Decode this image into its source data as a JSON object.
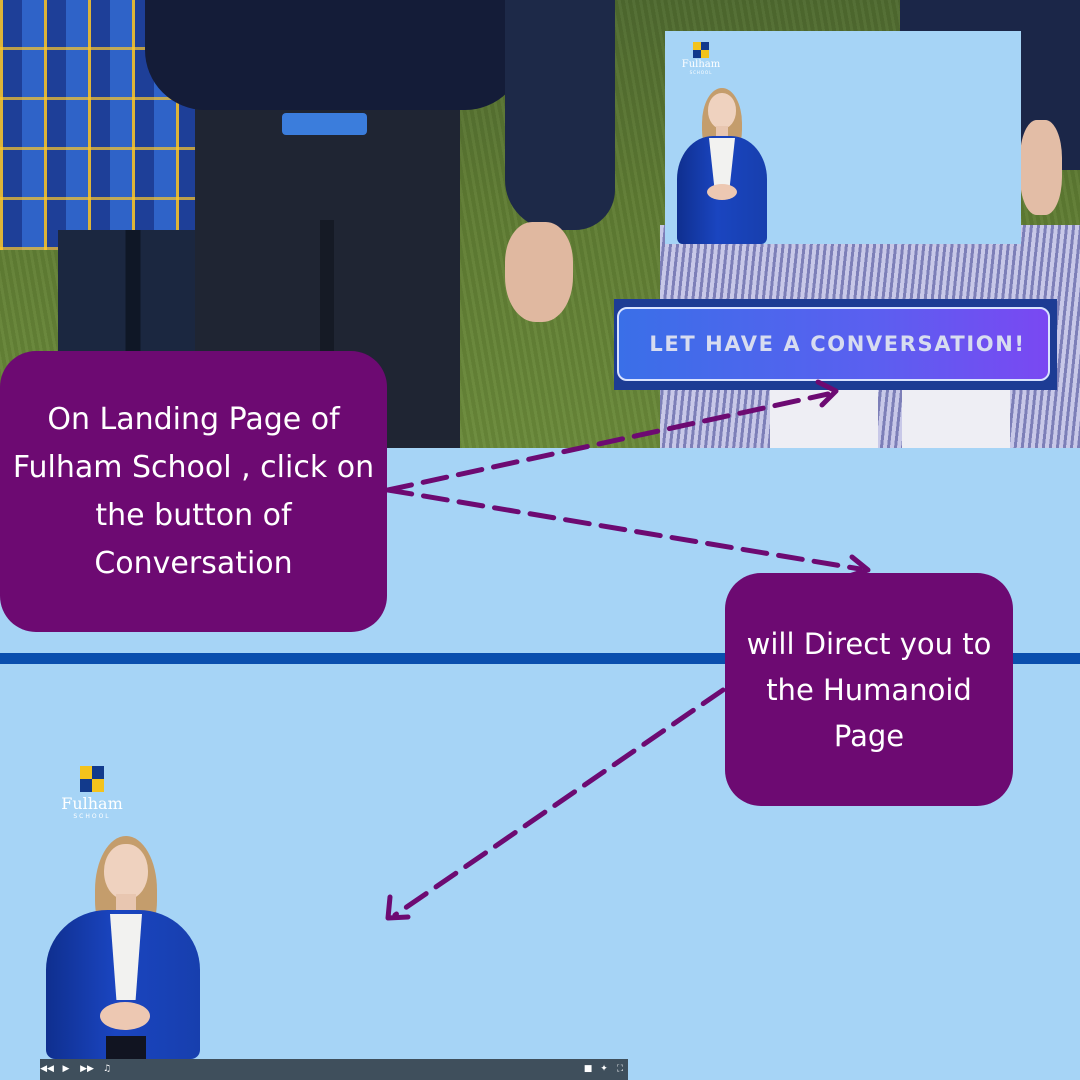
{
  "landing_screenshot": {
    "cta_button_label": "LET HAVE A CONVERSATION!",
    "thumbnail_logo": {
      "name": "Fulham",
      "sub": "SCHOOL"
    }
  },
  "callouts": {
    "step_one": "On Landing Page of Fulham School , click on the button of Conversation",
    "step_two": "will Direct you to the Humanoid Page"
  },
  "humanoid_page": {
    "logo": {
      "name": "Fulham",
      "sub": "SCHOOL"
    },
    "player_controls": [
      "rewind-icon",
      "play-icon",
      "fast-forward-icon",
      "volume-icon",
      "captions-icon",
      "settings-icon",
      "fullscreen-icon"
    ]
  },
  "colors": {
    "page_background": "#a6d4f6",
    "callout_fill": "#6d0a72",
    "arrow_color": "#6d0a72",
    "divider": "#0a4fae",
    "cta_gradient_start": "#3a6fe8",
    "cta_gradient_end": "#7a48f2",
    "logo_yellow": "#f4c31c",
    "logo_navy": "#123a8c"
  }
}
